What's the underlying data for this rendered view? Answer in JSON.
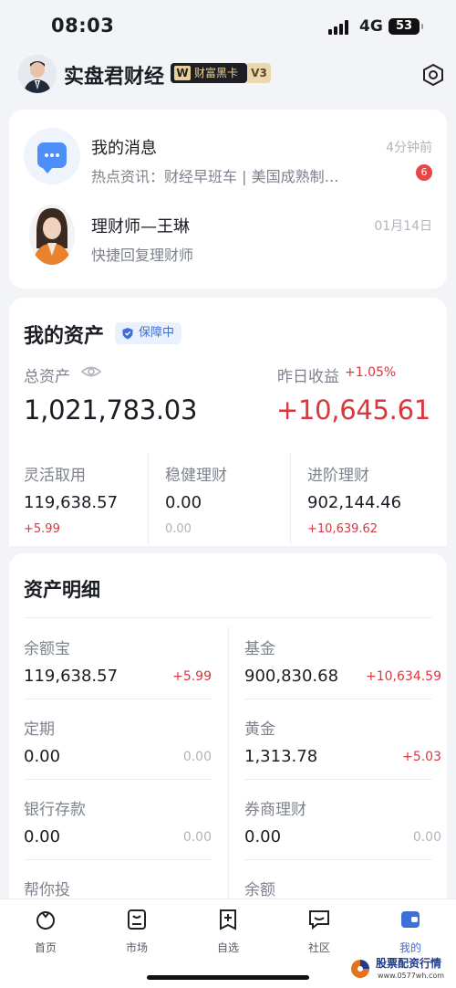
{
  "status": {
    "time": "08:03",
    "network": "4G",
    "battery": "53"
  },
  "profile": {
    "name": "实盘君财经",
    "vip_badge": "财富黑卡",
    "vip_level": "V3"
  },
  "messages": [
    {
      "title": "我的消息",
      "subtitle": "热点资讯：财经早班车 | 美国成熟制…",
      "time": "4分钟前",
      "badge": "6"
    },
    {
      "title": "理财师—王琳",
      "subtitle": "快捷回复理财师",
      "time": "01月14日"
    }
  ],
  "assets": {
    "title": "我的资产",
    "protect_badge": "保障中",
    "total_label": "总资产",
    "total_value": "1,021,783.03",
    "yesterday_label": "昨日收益",
    "yesterday_pct": "+1.05%",
    "yesterday_value": "+10,645.61",
    "subs": [
      {
        "label": "灵活取用",
        "value": "119,638.57",
        "change": "+5.99"
      },
      {
        "label": "稳健理财",
        "value": "0.00",
        "change": "0.00"
      },
      {
        "label": "进阶理财",
        "value": "902,144.46",
        "change": "+10,639.62"
      }
    ]
  },
  "details": {
    "title": "资产明细",
    "left": [
      {
        "label": "余额宝",
        "value": "119,638.57",
        "change": "+5.99"
      },
      {
        "label": "定期",
        "value": "0.00",
        "change": "0.00"
      },
      {
        "label": "银行存款",
        "value": "0.00",
        "change": "0.00"
      },
      {
        "label": "帮你投",
        "value": "",
        "change": ""
      }
    ],
    "right": [
      {
        "label": "基金",
        "value": "900,830.68",
        "change": "+10,634.59"
      },
      {
        "label": "黄金",
        "value": "1,313.78",
        "change": "+5.03"
      },
      {
        "label": "券商理财",
        "value": "0.00",
        "change": "0.00"
      },
      {
        "label": "余额",
        "value": "",
        "change": ""
      }
    ]
  },
  "tabs": [
    {
      "label": "首页",
      "icon": "home-icon"
    },
    {
      "label": "市场",
      "icon": "market-icon"
    },
    {
      "label": "自选",
      "icon": "watchlist-icon"
    },
    {
      "label": "社区",
      "icon": "community-icon"
    },
    {
      "label": "我的",
      "icon": "profile-wallet-icon"
    }
  ],
  "watermark": {
    "title": "股票配资行情",
    "url": "www.0577wh.com"
  },
  "colors": {
    "accent": "#3d6fd6",
    "gain": "#d9363e",
    "background": "#f2f4f7"
  }
}
